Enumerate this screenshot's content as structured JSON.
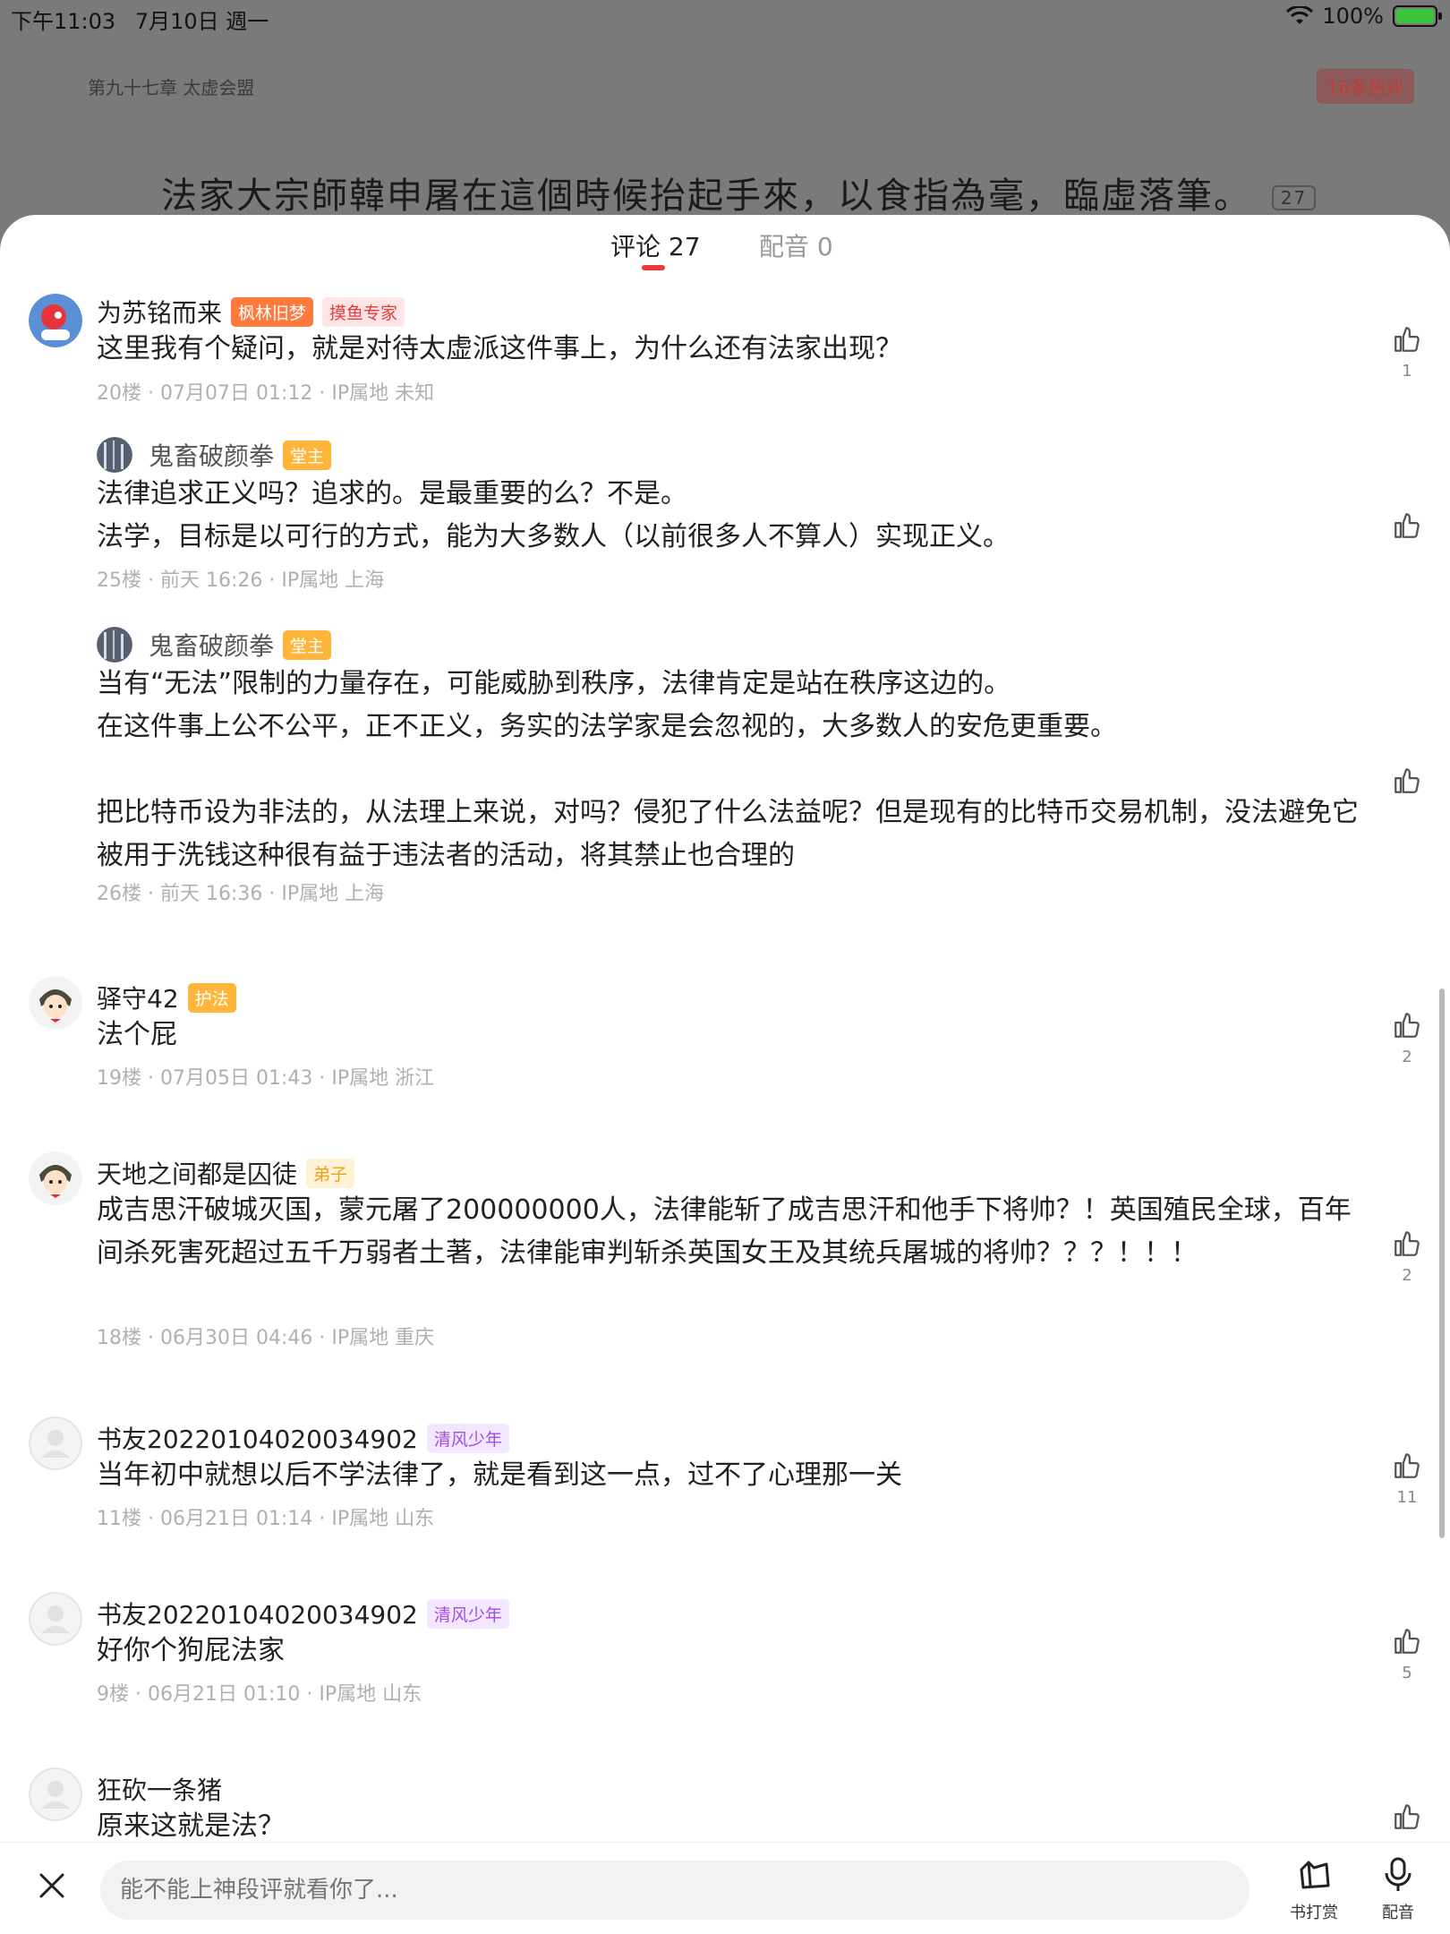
{
  "status_bar": {
    "time": "下午11:03",
    "date": "7月10日 週一",
    "battery_text": "100%"
  },
  "reader": {
    "chapter_title": "第九十七章 太虚会盟",
    "hot_comments": "16条热评",
    "line_text": "法家大宗師韓申屠在這個時候抬起手來，以食指為毫，臨虛落筆。",
    "line_comment_count": "27"
  },
  "tabs": {
    "comments": "评论 27",
    "dubbing": "配音 0"
  },
  "comments": [
    {
      "username": "为苏铭而来",
      "badges": [
        "枫林旧梦",
        "摸鱼专家"
      ],
      "text": "这里我有个疑问，就是对待太虚派这件事上，为什么还有法家出现？",
      "meta": "20楼 · 07月07日 01:12 · IP属地 未知",
      "likes": "1",
      "replies": [
        {
          "username": "鬼畜破颜拳",
          "badge": "堂主",
          "text": "法律追求正义吗？追求的。是最重要的么？不是。\n法学，目标是以可行的方式，能为大多数人（以前很多人不算人）实现正义。",
          "meta": "25楼 · 前天 16:26 · IP属地 上海"
        },
        {
          "username": "鬼畜破颜拳",
          "badge": "堂主",
          "text": "当有“无法”限制的力量存在，可能威胁到秩序，法律肯定是站在秩序这边的。\n在这件事上公不公平，正不正义，务实的法学家是会忽视的，大多数人的安危更重要。\n\n把比特币设为非法的，从法理上来说，对吗？侵犯了什么法益呢？但是现有的比特币交易机制，没法避免它被用于洗钱这种很有益于违法者的活动，将其禁止也合理的",
          "meta": "26楼 · 前天 16:36 · IP属地 上海"
        }
      ]
    },
    {
      "username": "驿守42",
      "badge": "护法",
      "text": "法个屁",
      "meta": "19楼 · 07月05日 01:43 · IP属地 浙江",
      "likes": "2"
    },
    {
      "username": "天地之间都是囚徒",
      "badge": "弟子",
      "text": "成吉思汗破城灭国，蒙元屠了200000000人，法律能斩了成吉思汗和他手下将帅？！英国殖民全球，百年间杀死害死超过五千万弱者土著，法律能审判斩杀英国女王及其统兵屠城的将帅？？？！！！",
      "meta": "18楼 · 06月30日 04:46 · IP属地 重庆",
      "likes": "2"
    },
    {
      "username": "书友20220104020034902",
      "badge": "清风少年",
      "text": "当年初中就想以后不学法律了，就是看到这一点，过不了心理那一关",
      "meta": "11楼 · 06月21日 01:14 · IP属地 山东",
      "likes": "11"
    },
    {
      "username": "书友20220104020034902",
      "badge": "清风少年",
      "text": "好你个狗屁法家",
      "meta": "9楼 · 06月21日 01:10 · IP属地 山东",
      "likes": "5"
    },
    {
      "username": "狂砍一条猪",
      "text": "原来这就是法？"
    }
  ],
  "bottom_bar": {
    "input_placeholder": "能不能上神段评就看你了...",
    "tip_label": "书打赏",
    "dub_label": "配音"
  },
  "colors": {
    "accent_red": "#e83b3b",
    "meta_gray": "#b0b0b0"
  }
}
